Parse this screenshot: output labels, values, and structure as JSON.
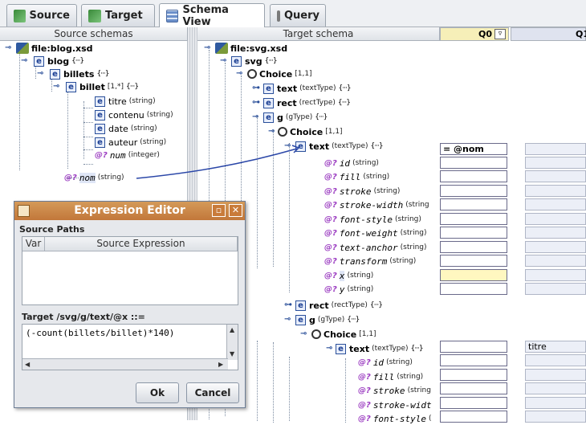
{
  "tabs": [
    {
      "label": "Source",
      "icon": "puzzle-green-icon"
    },
    {
      "label": "Target",
      "icon": "puzzle-green-icon"
    },
    {
      "label": "Schema View",
      "icon": "table-grid-icon"
    },
    {
      "label": "Query",
      "icon": "query-icon"
    }
  ],
  "left": {
    "header": "Source schemas",
    "nodes": [
      {
        "name": "file:blog.xsd"
      },
      {
        "name": "blog",
        "dots": "{···}"
      },
      {
        "name": "billets",
        "dots": "{···}"
      },
      {
        "name": "billet",
        "card": "[1,*]",
        "dots": "{···}"
      },
      {
        "name": "titre",
        "type": "(string)"
      },
      {
        "name": "contenu",
        "type": "(string)"
      },
      {
        "name": "date",
        "type": "(string)"
      },
      {
        "name": "auteur",
        "type": "(string)"
      },
      {
        "name": "num",
        "type": "(integer)"
      },
      {
        "name": "nom",
        "type": "(string)"
      }
    ]
  },
  "right": {
    "header": "Target schema",
    "q0": "Q0",
    "q0_btn": "▿",
    "q1": "Q1",
    "nodes": [
      {
        "name": "file:svg.xsd"
      },
      {
        "name": "svg",
        "dots": "{···}"
      },
      {
        "name": "Choice",
        "card": "[1,1]"
      },
      {
        "name": "text",
        "type": "(textType)",
        "dots": "{···}"
      },
      {
        "name": "rect",
        "type": "(rectType)",
        "dots": "{···}"
      },
      {
        "name": "g",
        "type": "(gType)",
        "dots": "{···}"
      },
      {
        "name": "Choice",
        "card": "[1,1]"
      },
      {
        "name": "text",
        "type": "(textType)",
        "dots": "{···}",
        "q0": "= @nom"
      },
      {
        "name": "id",
        "type": "(string)"
      },
      {
        "name": "fill",
        "type": "(string)"
      },
      {
        "name": "stroke",
        "type": "(string)"
      },
      {
        "name": "stroke-width",
        "type": "(string"
      },
      {
        "name": "font-style",
        "type": "(string)"
      },
      {
        "name": "font-weight",
        "type": "(string)"
      },
      {
        "name": "text-anchor",
        "type": "(string)"
      },
      {
        "name": "transform",
        "type": "(string)"
      },
      {
        "name": "x",
        "type": "(string)"
      },
      {
        "name": "y",
        "type": "(string)"
      },
      {
        "name": "rect",
        "type": "(rectType)",
        "dots": "{···}"
      },
      {
        "name": "g",
        "type": "(gType)",
        "dots": "{···}"
      },
      {
        "name": "Choice",
        "card": "[1,1]"
      },
      {
        "name": "text",
        "type": "(textType)",
        "dots": "{···}",
        "q1": "titre"
      },
      {
        "name": "id",
        "type": "(string)"
      },
      {
        "name": "fill",
        "type": "(string)"
      },
      {
        "name": "stroke",
        "type": "(string"
      },
      {
        "name": "stroke-widt",
        "type": ""
      },
      {
        "name": "font-style",
        "type": "("
      }
    ]
  },
  "dialog": {
    "title": "Expression Editor",
    "source_paths_label": "Source Paths",
    "col_var": "Var",
    "col_expr": "Source Expression",
    "target_label": "Target /svg/g/text/@x ::=",
    "expression": "(-count(billets/billet)*140)",
    "ok": "Ok",
    "cancel": "Cancel"
  }
}
